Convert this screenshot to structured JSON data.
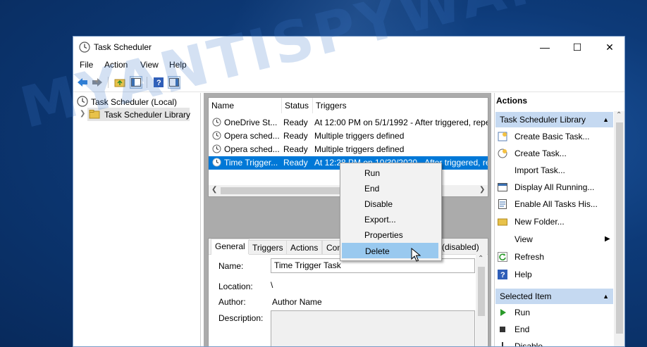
{
  "window": {
    "title": "Task Scheduler"
  },
  "menu": [
    "File",
    "Action",
    "View",
    "Help"
  ],
  "tree": {
    "root": "Task Scheduler (Local)",
    "child": "Task Scheduler Library"
  },
  "list": {
    "columns": [
      "Name",
      "Status",
      "Triggers"
    ],
    "rows": [
      {
        "name": "OneDrive St...",
        "status": "Ready",
        "triggers": "At 12:00 PM on 5/1/1992 - After triggered, repe"
      },
      {
        "name": "Opera sched...",
        "status": "Ready",
        "triggers": "Multiple triggers defined"
      },
      {
        "name": "Opera sched...",
        "status": "Ready",
        "triggers": "Multiple triggers defined"
      },
      {
        "name": "Time Trigger...",
        "status": "Ready",
        "triggers": "At 12:28 PM on 10/30/2020 - After triggered, re"
      }
    ]
  },
  "tabs": [
    "General",
    "Triggers",
    "Actions",
    "Con",
    "(disabled)"
  ],
  "details": {
    "name_label": "Name:",
    "name_value": "Time Trigger Task",
    "location_label": "Location:",
    "location_value": "\\",
    "author_label": "Author:",
    "author_value": "Author Name",
    "description_label": "Description:"
  },
  "context_menu": [
    "Run",
    "End",
    "Disable",
    "Export...",
    "Properties",
    "Delete"
  ],
  "actions": {
    "header": "Actions",
    "section1": "Task Scheduler Library",
    "items1": [
      "Create Basic Task...",
      "Create Task...",
      "Import Task...",
      "Display All Running...",
      "Enable All Tasks His...",
      "New Folder...",
      "View",
      "Refresh",
      "Help"
    ],
    "section2": "Selected Item",
    "items2": [
      "Run",
      "End",
      "Disable"
    ]
  },
  "watermark": "MYANTISPYWARE.COM",
  "colors": {
    "selection": "#0078d7",
    "section": "#c5d9f1",
    "menu_highlight": "#99c9ef"
  }
}
